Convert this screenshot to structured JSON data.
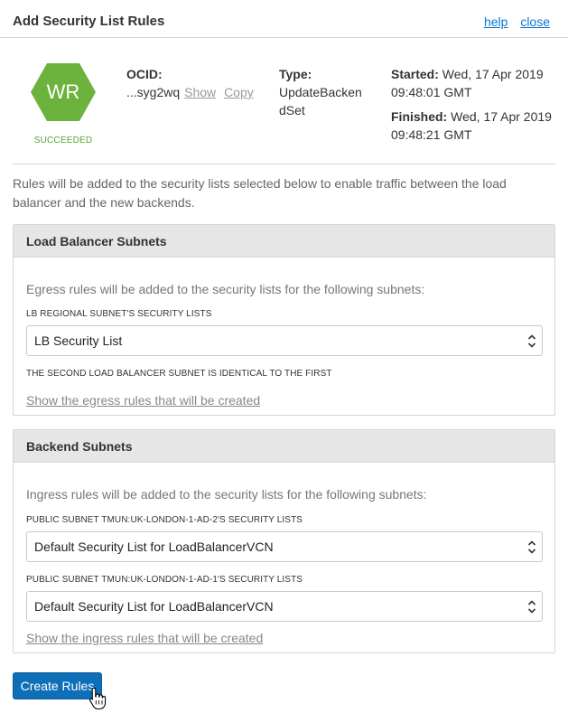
{
  "dialog": {
    "title": "Add Security List Rules",
    "help_label": "help",
    "close_label": "close"
  },
  "work_request": {
    "badge_initials": "WR",
    "badge_color": "#6cb33e",
    "status": "SUCCEEDED",
    "ocid_label": "OCID:",
    "ocid_value": "...syg2wq",
    "show_label": "Show",
    "copy_label": "Copy",
    "type_label": "Type:",
    "type_value": "UpdateBackendSet",
    "started_label": "Started:",
    "started_value": "Wed, 17 Apr 2019 09:48:01 GMT",
    "finished_label": "Finished:",
    "finished_value": "Wed, 17 Apr 2019 09:48:21 GMT"
  },
  "intro_text": "Rules will be added to the security lists selected below to enable traffic between the load balancer and the new backends.",
  "lb_panel": {
    "title": "Load Balancer Subnets",
    "description": "Egress rules will be added to the security lists for the following subnets:",
    "regional_caption": "LB REGIONAL SUBNET'S SECURITY LISTS",
    "regional_selected": "LB Security List",
    "second_subnet_note": "THE SECOND LOAD BALANCER SUBNET IS IDENTICAL TO THE FIRST",
    "show_rules_link": "Show the egress rules that will be created"
  },
  "backend_panel": {
    "title": "Backend Subnets",
    "description": "Ingress rules will be added to the security lists for the following subnets:",
    "subnet1_caption": "PUBLIC SUBNET TMUN:UK-LONDON-1-AD-2'S SECURITY LISTS",
    "subnet1_selected": "Default Security List for LoadBalancerVCN",
    "subnet2_caption": "PUBLIC SUBNET TMUN:UK-LONDON-1-AD-1'S SECURITY LISTS",
    "subnet2_selected": "Default Security List for LoadBalancerVCN",
    "show_rules_link": "Show the ingress rules that will be created"
  },
  "actions": {
    "create_label": "Create Rules"
  },
  "colors": {
    "accent": "#0d6fb8",
    "link": "#0b76d6",
    "success": "#5aa332"
  }
}
